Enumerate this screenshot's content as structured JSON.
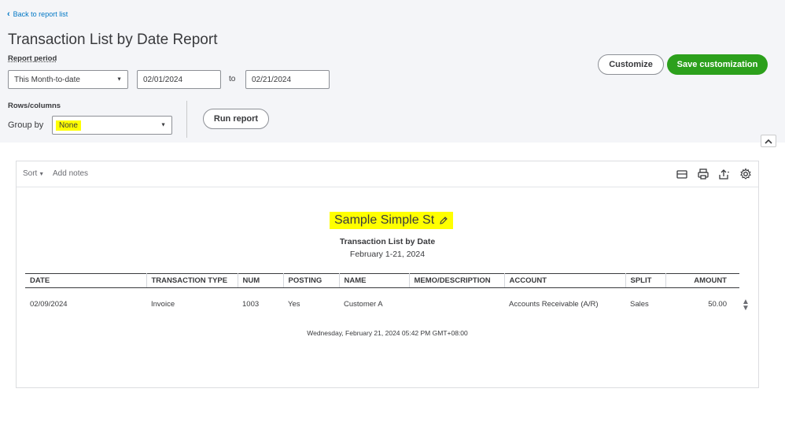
{
  "header": {
    "back_link": "Back to report list",
    "title": "Transaction List by Date Report",
    "report_period_label": "Report period",
    "period_value": "This Month-to-date",
    "from_date": "02/01/2024",
    "to_label": "to",
    "to_date": "02/21/2024",
    "rows_columns_label": "Rows/columns",
    "group_by_label": "Group by",
    "group_by_value": "None",
    "run_report": "Run report",
    "customize": "Customize",
    "save_customization": "Save customization"
  },
  "toolbar": {
    "sort": "Sort",
    "add_notes": "Add notes",
    "icons": [
      "email-icon",
      "print-icon",
      "export-icon",
      "gear-icon"
    ]
  },
  "report": {
    "company": "Sample Simple St",
    "title": "Transaction List by Date",
    "range": "February 1-21, 2024",
    "columns": [
      "DATE",
      "TRANSACTION TYPE",
      "NUM",
      "POSTING",
      "NAME",
      "MEMO/DESCRIPTION",
      "ACCOUNT",
      "SPLIT",
      "AMOUNT"
    ],
    "rows": [
      [
        "02/09/2024",
        "Invoice",
        "1003",
        "Yes",
        "Customer A",
        "",
        "Accounts Receivable (A/R)",
        "Sales",
        "50.00"
      ]
    ],
    "footer": "Wednesday, February 21, 2024   05:42 PM GMT+08:00"
  },
  "colors": {
    "accent_link": "#0077c5",
    "primary_button": "#2ca01c",
    "highlight": "#ffff00"
  }
}
